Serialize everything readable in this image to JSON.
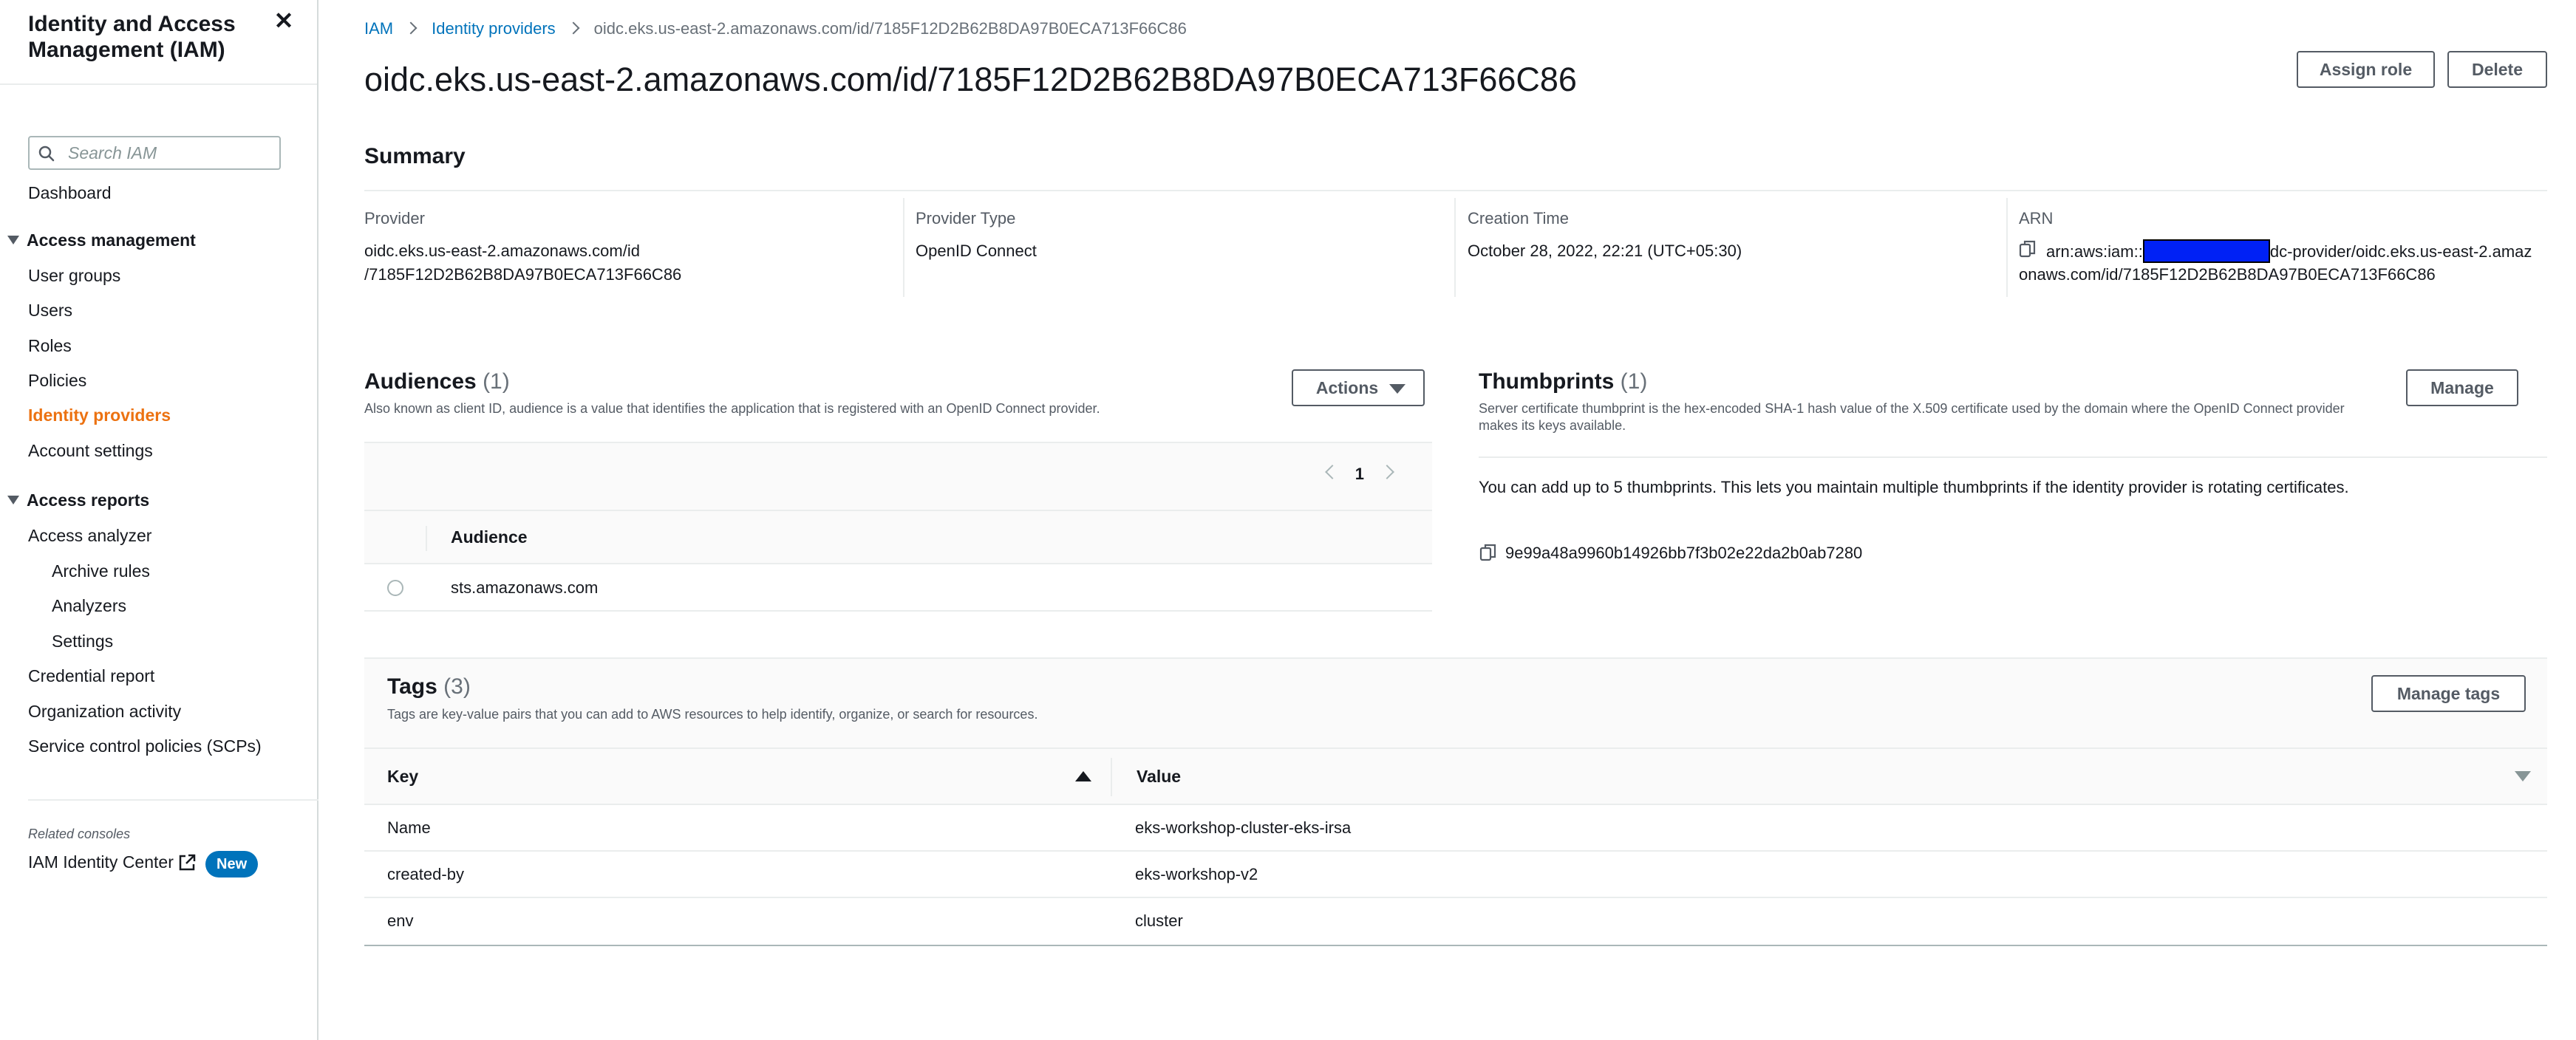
{
  "sidebar": {
    "title": "Identity and Access Management (IAM)",
    "search_placeholder": "Search IAM",
    "dashboard": "Dashboard",
    "sections": [
      {
        "label": "Access management",
        "items": [
          "User groups",
          "Users",
          "Roles",
          "Policies",
          "Identity providers",
          "Account settings"
        ],
        "active": "Identity providers"
      },
      {
        "label": "Access reports",
        "items": [
          "Access analyzer",
          "Archive rules",
          "Analyzers",
          "Settings",
          "Credential report",
          "Organization activity",
          "Service control policies (SCPs)"
        ]
      }
    ],
    "related_label": "Related consoles",
    "identity_center": "IAM Identity Center",
    "new_badge": "New"
  },
  "breadcrumb": {
    "items": [
      "IAM",
      "Identity providers"
    ],
    "current": "oidc.eks.us-east-2.amazonaws.com/id/7185F12D2B62B8DA97B0ECA713F66C86"
  },
  "page": {
    "title": "oidc.eks.us-east-2.amazonaws.com/id/7185F12D2B62B8DA97B0ECA713F66C86",
    "assign_role": "Assign role",
    "delete": "Delete"
  },
  "summary": {
    "title": "Summary",
    "provider_label": "Provider",
    "provider_value_1": "oidc.eks.us-east-2.amazonaws.com/id",
    "provider_value_2": "/7185F12D2B62B8DA97B0ECA713F66C86",
    "type_label": "Provider Type",
    "type_value": "OpenID Connect",
    "time_label": "Creation Time",
    "time_value": "October 28, 2022, 22:21 (UTC+05:30)",
    "arn_label": "ARN",
    "arn_prefix": "arn:aws:iam::",
    "arn_suffix": "dc-provider/oidc.eks.us-east-2.amaz",
    "arn_line2": "onaws.com/id/7185F12D2B62B8DA97B0ECA713F66C86"
  },
  "audiences": {
    "title": "Audiences",
    "count": "(1)",
    "description": "Also known as client ID, audience is a value that identifies the application that is registered with an OpenID Connect provider.",
    "actions": "Actions",
    "page": "1",
    "column": "Audience",
    "rows": [
      "sts.amazonaws.com"
    ]
  },
  "thumbprints": {
    "title": "Thumbprints",
    "count": "(1)",
    "description": "Server certificate thumbprint is the hex-encoded SHA-1 hash value of the X.509 certificate used by the domain where the OpenID Connect provider makes its keys available.",
    "manage": "Manage",
    "info": "You can add up to 5 thumbprints. This lets you maintain multiple thumbprints if the identity provider is rotating certificates.",
    "value": "9e99a48a9960b14926bb7f3b02e22da2b0ab7280"
  },
  "tags": {
    "title": "Tags",
    "count": "(3)",
    "description": "Tags are key-value pairs that you can add to AWS resources to help identify, organize, or search for resources.",
    "manage": "Manage tags",
    "key_header": "Key",
    "value_header": "Value",
    "rows": [
      {
        "key": "Name",
        "value": "eks-workshop-cluster-eks-irsa"
      },
      {
        "key": "created-by",
        "value": "eks-workshop-v2"
      },
      {
        "key": "env",
        "value": "cluster"
      }
    ]
  }
}
